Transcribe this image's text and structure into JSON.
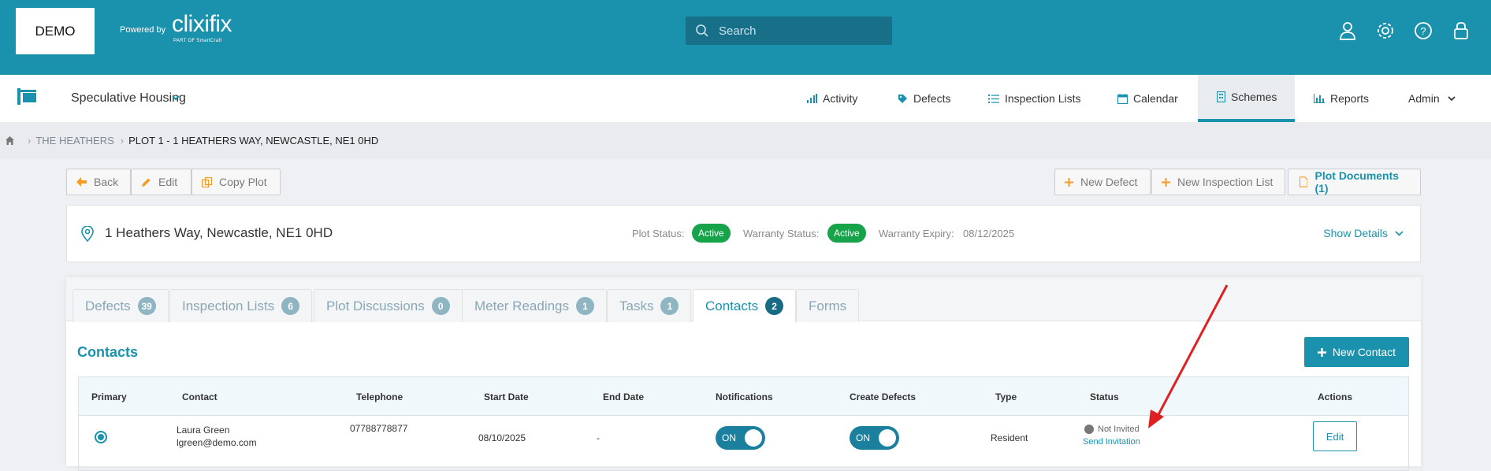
{
  "header": {
    "logo_text": "DEMO",
    "powered_by": "Powered by",
    "brand": "clixifix",
    "brand_sub": "PART OF SmartCraft",
    "search_placeholder": "Search"
  },
  "nav": {
    "project_name": "Speculative Housing",
    "items": [
      {
        "label": "Activity",
        "icon": "bar-chart-icon"
      },
      {
        "label": "Defects",
        "icon": "tag-icon"
      },
      {
        "label": "Inspection Lists",
        "icon": "list-icon"
      },
      {
        "label": "Calendar",
        "icon": "calendar-icon"
      },
      {
        "label": "Schemes",
        "icon": "building-icon"
      },
      {
        "label": "Reports",
        "icon": "report-icon"
      },
      {
        "label": "Admin",
        "icon": "chevron-down-icon"
      }
    ],
    "active": "Schemes"
  },
  "breadcrumb": {
    "parent": "THE HEATHERS",
    "current": "PLOT 1 - 1 HEATHERS WAY, NEWCASTLE, NE1 0HD"
  },
  "toolbar": {
    "back": "Back",
    "edit": "Edit",
    "copy_plot": "Copy Plot",
    "new_defect": "New Defect",
    "new_inspection_list": "New Inspection List",
    "plot_documents": "Plot Documents (1)"
  },
  "plot": {
    "address": "1 Heathers Way, Newcastle, NE1 0HD",
    "plot_status_label": "Plot Status:",
    "plot_status": "Active",
    "warranty_status_label": "Warranty Status:",
    "warranty_status": "Active",
    "warranty_expiry_label": "Warranty Expiry:",
    "warranty_expiry": "08/12/2025",
    "show_details": "Show Details"
  },
  "tabs": [
    {
      "label": "Defects",
      "count": "39"
    },
    {
      "label": "Inspection Lists",
      "count": "6"
    },
    {
      "label": "Plot Discussions",
      "count": "0"
    },
    {
      "label": "Meter Readings",
      "count": "1"
    },
    {
      "label": "Tasks",
      "count": "1"
    },
    {
      "label": "Contacts",
      "count": "2"
    },
    {
      "label": "Forms",
      "count": ""
    }
  ],
  "contacts": {
    "title": "Contacts",
    "new_contact": "New Contact",
    "columns": [
      "Primary",
      "Contact",
      "Telephone",
      "Start Date",
      "End Date",
      "Notifications",
      "Create Defects",
      "Type",
      "Status",
      "Actions"
    ],
    "rows": [
      {
        "name": "Laura Green",
        "email": "lgreen@demo.com",
        "telephone": "07788778877",
        "start_date": "08/10/2025",
        "end_date": "-",
        "notifications": "ON",
        "create_defects": "ON",
        "type": "Resident",
        "status": "Not Invited",
        "status_action": "Send Invitation",
        "action": "Edit"
      }
    ]
  },
  "colors": {
    "brand": "#1b92ad",
    "active_green": "#17a34a",
    "annotation_arrow": "#e02020"
  }
}
